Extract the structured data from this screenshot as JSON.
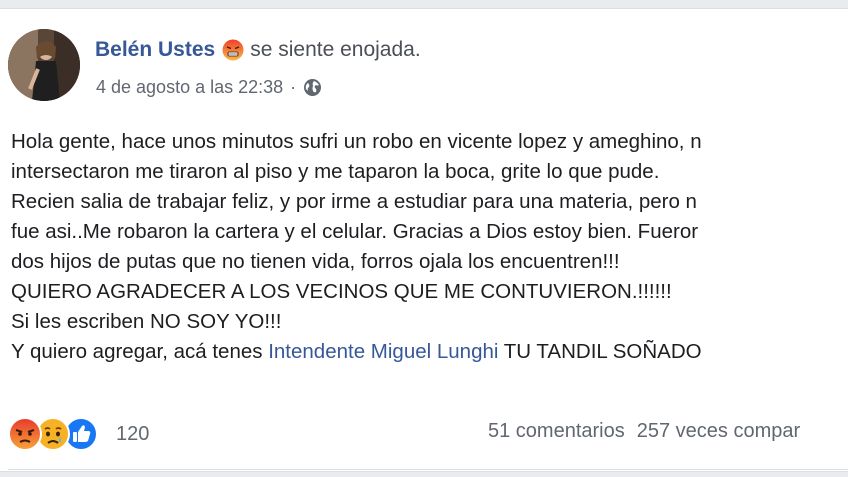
{
  "post": {
    "author": "Belén Ustes",
    "feeling_text": "se siente enojada.",
    "feeling_icon": "angry-face-icon",
    "timestamp": "4 de agosto a las 22:38",
    "separator": "·",
    "privacy_icon": "globe-icon",
    "body_lines": [
      {
        "text": "Hola gente, hace unos minutos sufri un robo en vicente lopez y ameghino, n"
      },
      {
        "text": "intersectaron me tiraron al piso y me taparon la boca, grite lo que pude."
      },
      {
        "text": "Recien salia de trabajar feliz, y por irme a estudiar para una materia, pero n"
      },
      {
        "text": "fue asi..Me robaron la cartera y el celular. Gracias a Dios estoy bien. Fueror"
      },
      {
        "text": "dos hijos de putas que no tienen vida, forros ojala los encuentren!!!"
      },
      {
        "text": "QUIERO AGRADECER A LOS VECINOS QUE ME CONTUVIERON.!!!!!!"
      },
      {
        "text": "Si les escriben NO SOY YO!!!"
      }
    ],
    "last_line": {
      "prefix": "Y quiero agregar, acá tenes ",
      "mention": "Intendente Miguel Lunghi",
      "suffix": " TU TANDIL SOÑADO"
    }
  },
  "reactions": {
    "icons": [
      "angry-reaction-icon",
      "sad-reaction-icon",
      "like-reaction-icon"
    ],
    "count": "120"
  },
  "stats": {
    "comments": "51 comentarios",
    "shares": "257 veces compar"
  },
  "colors": {
    "link": "#365899",
    "text": "#1c1e21",
    "meta": "#616770",
    "like": "#1877f2",
    "angry": "#e9710f",
    "sad": "#f7b125"
  }
}
